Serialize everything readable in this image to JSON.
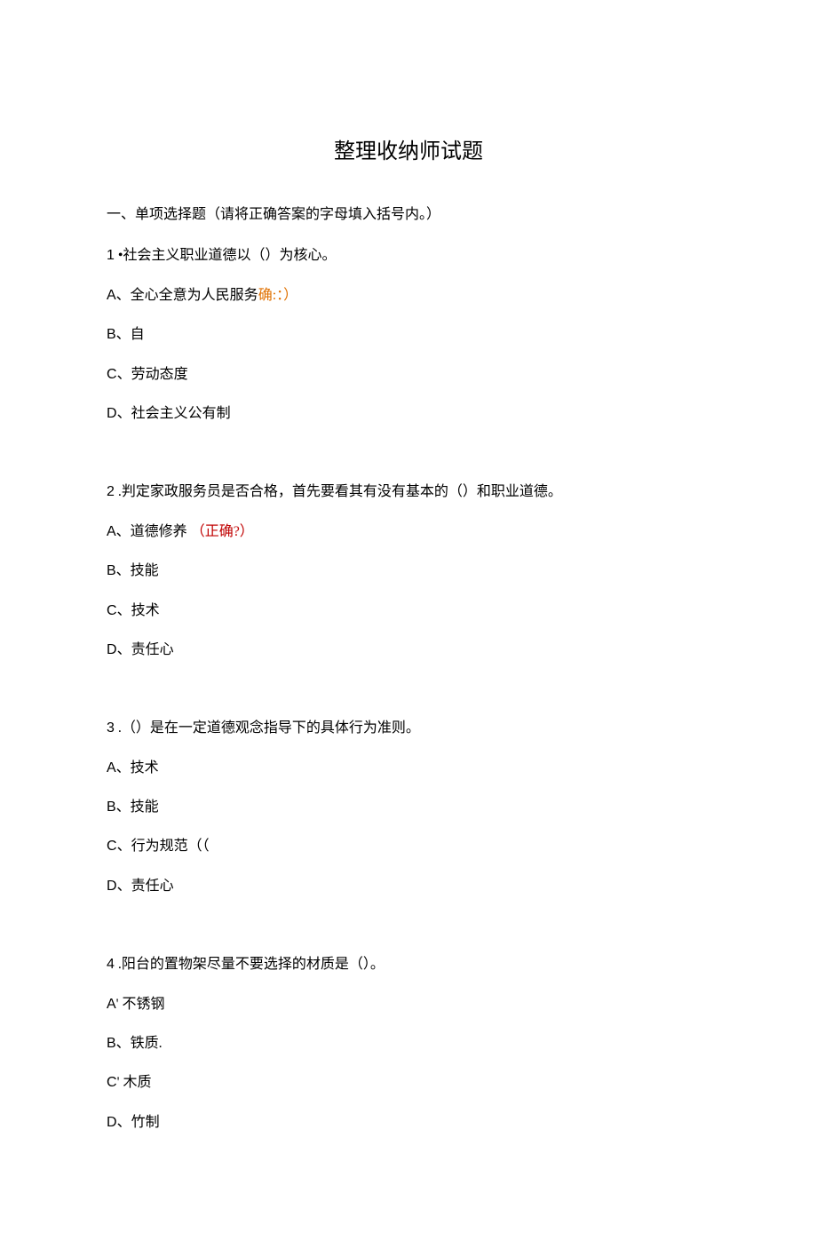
{
  "title": "整理收纳师试题",
  "instruction": "一、单项选择题（请将正确答案的字母填入括号内。）",
  "questions": {
    "q1": {
      "num": "1",
      "text": " •社会主义职业道德以（）为核心。",
      "optA_letter": "A",
      "optA_text": "、全心全意为人民服务",
      "optA_mark": "确:：）",
      "optB_letter": "B",
      "optB_text": "、自",
      "optC_letter": "C",
      "optC_text": "、劳动态度",
      "optD_letter": "D",
      "optD_text": "、社会主义公有制"
    },
    "q2": {
      "num": "2",
      "text": " .判定家政服务员是否合格，首先要看其有没有基本的（）和职业道德。",
      "optA_letter": "A",
      "optA_text": "、道德修养",
      "optA_mark": "（正确?）",
      "optB_letter": "B",
      "optB_text": "、技能",
      "optC_letter": "C",
      "optC_text": "、技术",
      "optD_letter": "D",
      "optD_text": "、责任心"
    },
    "q3": {
      "num": "3",
      "text": " .（）是在一定道德观念指导下的具体行为准则。",
      "optA_letter": "A",
      "optA_text": "、技术",
      "optB_letter": "B",
      "optB_text": "、技能",
      "optC_letter": "C",
      "optC_text": "、行为规范（（",
      "optD_letter": "D",
      "optD_text": "、责任心"
    },
    "q4": {
      "num": "4",
      "text": " .阳台的置物架尽量不要选择的材质是（）。",
      "optA_letter": "A",
      "optA_text": "' 不锈钢",
      "optB_letter": "B",
      "optB_text": "、铁质.",
      "optC_letter": "C",
      "optC_text": "' 木质",
      "optD_letter": "D",
      "optD_text": "、竹制"
    }
  }
}
